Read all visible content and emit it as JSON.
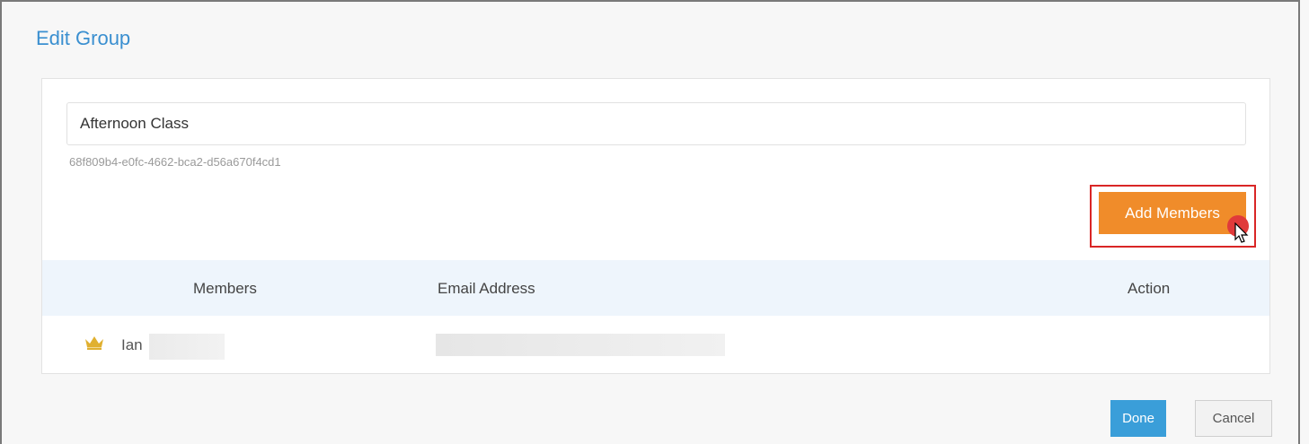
{
  "dialog": {
    "title": "Edit Group"
  },
  "group": {
    "name_value": "Afternoon Class",
    "id": "68f809b4-e0fc-4662-bca2-d56a670f4cd1"
  },
  "actions": {
    "add_members_label": "Add Members"
  },
  "table": {
    "headers": {
      "members": "Members",
      "email": "Email Address",
      "action": "Action"
    },
    "rows": [
      {
        "member_name": "Ian",
        "role_icon": "crown-icon",
        "email": ""
      }
    ]
  },
  "footer": {
    "done_label": "Done",
    "cancel_label": "Cancel"
  },
  "colors": {
    "title": "#3a8fd0",
    "add_button": "#f08c2a",
    "done_button": "#3a9ed9",
    "highlight": "#d92626",
    "table_header_bg": "#eef5fc",
    "crown": "#e0b030"
  }
}
